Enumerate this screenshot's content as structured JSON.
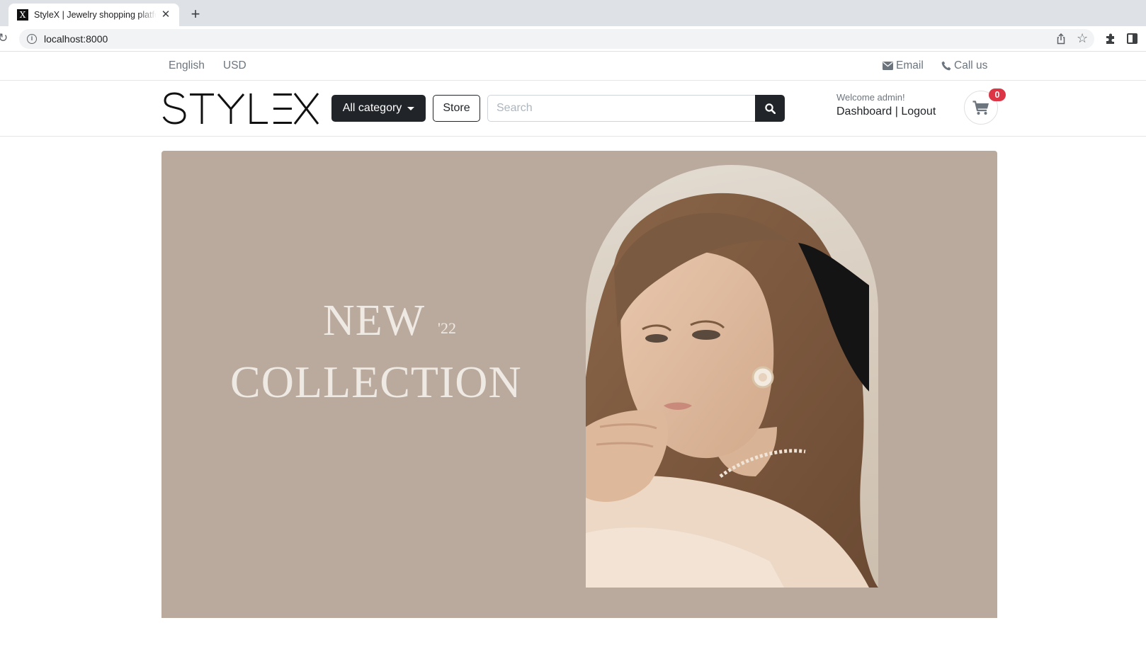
{
  "browser": {
    "tab_title": "StyleX | Jewelry shopping platform",
    "favicon_letter": "X",
    "url": "localhost:8000"
  },
  "topbar": {
    "language": "English",
    "currency": "USD",
    "email_label": "Email",
    "call_label": "Call us"
  },
  "header": {
    "logo_text": "STYLEX",
    "category_button": "All category",
    "store_button": "Store",
    "search_placeholder": "Search",
    "welcome_text": "Welcome admin!",
    "dashboard_link": "Dashboard",
    "separator": " | ",
    "logout_link": "Logout",
    "cart_count": "0"
  },
  "hero": {
    "headline_1": "NEW",
    "year": "'22",
    "headline_2": "COLLECTION"
  },
  "colors": {
    "dark": "#212529",
    "hero_bg": "#b9aa9d",
    "hero_text": "#efe9e3",
    "badge": "#dc3545"
  },
  "icons": [
    "info-icon",
    "share-icon",
    "star-icon",
    "puzzle-icon",
    "side-panel-icon",
    "envelope-icon",
    "phone-icon",
    "search-icon",
    "cart-icon",
    "reload-icon",
    "close-icon",
    "plus-icon"
  ]
}
